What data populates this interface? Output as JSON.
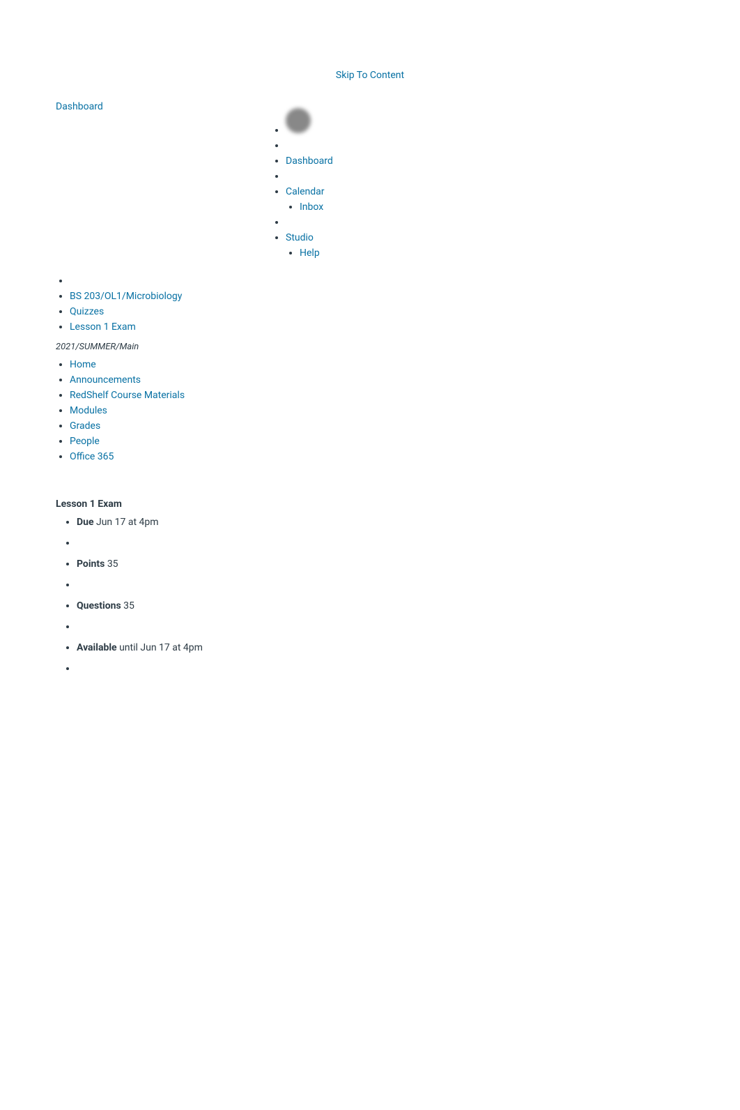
{
  "skip_link": "Skip To Content",
  "dashboard_link": "Dashboard",
  "right_nav": {
    "items": [
      {
        "label": "",
        "type": "avatar"
      },
      {
        "label": "",
        "type": "empty"
      },
      {
        "label": "Dashboard",
        "type": "link"
      },
      {
        "label": "",
        "type": "empty"
      },
      {
        "label": "Calendar",
        "type": "link"
      },
      {
        "label": "Inbox",
        "type": "link-indent"
      },
      {
        "label": "",
        "type": "empty"
      },
      {
        "label": "Studio",
        "type": "link"
      },
      {
        "label": "Help",
        "type": "link-indent"
      }
    ]
  },
  "left_nav": {
    "items": [
      {
        "label": "",
        "type": "empty"
      },
      {
        "label": "BS 203/OL1/Microbiology",
        "type": "link"
      },
      {
        "label": "Quizzes",
        "type": "link"
      },
      {
        "label": "Lesson 1 Exam",
        "type": "link"
      }
    ]
  },
  "course_path": "2021/SUMMER/Main",
  "course_nav": {
    "items": [
      {
        "label": "Home",
        "type": "link"
      },
      {
        "label": "Announcements",
        "type": "link"
      },
      {
        "label": "RedShelf Course Materials",
        "type": "link"
      },
      {
        "label": "Modules",
        "type": "link"
      },
      {
        "label": "Grades",
        "type": "link"
      },
      {
        "label": "People",
        "type": "link"
      },
      {
        "label": "Office 365",
        "type": "link"
      }
    ]
  },
  "exam": {
    "title": "Lesson 1 Exam",
    "items": [
      {
        "label": "Due",
        "value": "Jun 17 at 4pm"
      },
      {
        "label": "",
        "value": ""
      },
      {
        "label": "Points",
        "value": "35"
      },
      {
        "label": "",
        "value": ""
      },
      {
        "label": "Questions",
        "value": "35"
      },
      {
        "label": "",
        "value": ""
      },
      {
        "label": "Available",
        "value": "until Jun 17 at 4pm"
      },
      {
        "label": "",
        "value": ""
      }
    ]
  }
}
